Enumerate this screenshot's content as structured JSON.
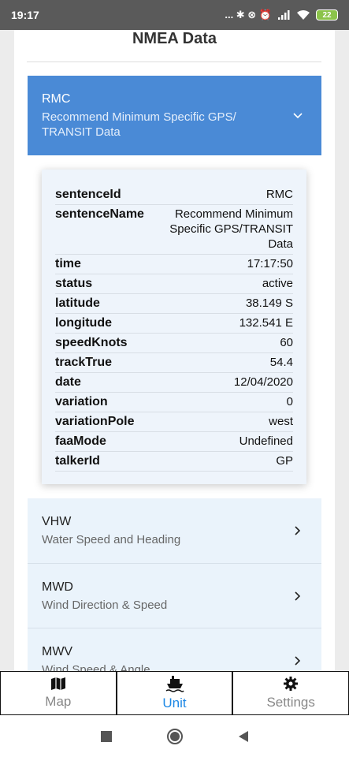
{
  "status_bar": {
    "time": "19:17",
    "icons": "... ✱ ⊗ ⏰",
    "battery": "22"
  },
  "page_title": "NMEA Data",
  "expanded": {
    "code": "RMC",
    "desc_line1": "Recommend Minimum Specific GPS/",
    "desc_line2": "TRANSIT Data"
  },
  "fields": [
    {
      "key": "sentenceId",
      "value": "RMC"
    },
    {
      "key": "sentenceName",
      "value": "Recommend Minimum",
      "value2": "Specific GPS/TRANSIT",
      "value3": "Data"
    },
    {
      "key": "time",
      "value": "17:17:50"
    },
    {
      "key": "status",
      "value": "active"
    },
    {
      "key": "latitude",
      "value": "38.149 S"
    },
    {
      "key": "longitude",
      "value": "132.541 E"
    },
    {
      "key": "speedKnots",
      "value": "60"
    },
    {
      "key": "trackTrue",
      "value": "54.4"
    },
    {
      "key": "date",
      "value": "12/04/2020"
    },
    {
      "key": "variation",
      "value": "0"
    },
    {
      "key": "variationPole",
      "value": "west"
    },
    {
      "key": "faaMode",
      "value": "Undefined"
    },
    {
      "key": "talkerId",
      "value": "GP"
    }
  ],
  "sentences": [
    {
      "code": "VHW",
      "desc": "Water Speed and Heading"
    },
    {
      "code": "MWD",
      "desc": "Wind Direction & Speed"
    },
    {
      "code": "MWV",
      "desc": "Wind Speed & Angle"
    }
  ],
  "tabs": [
    {
      "label": "Map",
      "icon": "map-icon"
    },
    {
      "label": "Unit",
      "icon": "ship-icon",
      "active": true
    },
    {
      "label": "Settings",
      "icon": "gear-icon"
    }
  ],
  "colors": {
    "accent": "#4a8ad6",
    "active_tab": "#1e88e5",
    "panel": "#eef4fb"
  }
}
